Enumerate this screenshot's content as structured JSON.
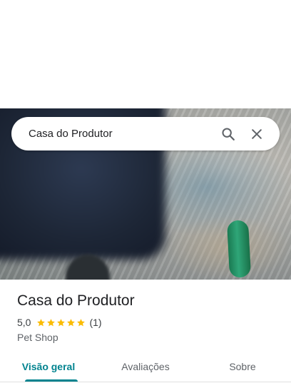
{
  "search": {
    "query": "Casa do Produtor",
    "search_icon": "search-icon",
    "close_icon": "close-icon"
  },
  "photo": {
    "icon": "place-photo"
  },
  "place": {
    "name": "Casa do Produtor",
    "rating": "5,0",
    "stars": 5,
    "review_count": "(1)",
    "category": "Pet Shop",
    "star_color": "#fbbc04"
  },
  "tabs": [
    {
      "label": "Visão geral",
      "active": true
    },
    {
      "label": "Avaliações",
      "active": false
    },
    {
      "label": "Sobre",
      "active": false
    }
  ],
  "colors": {
    "accent": "#00838f",
    "text_primary": "#202124",
    "text_secondary": "#5f6368"
  }
}
